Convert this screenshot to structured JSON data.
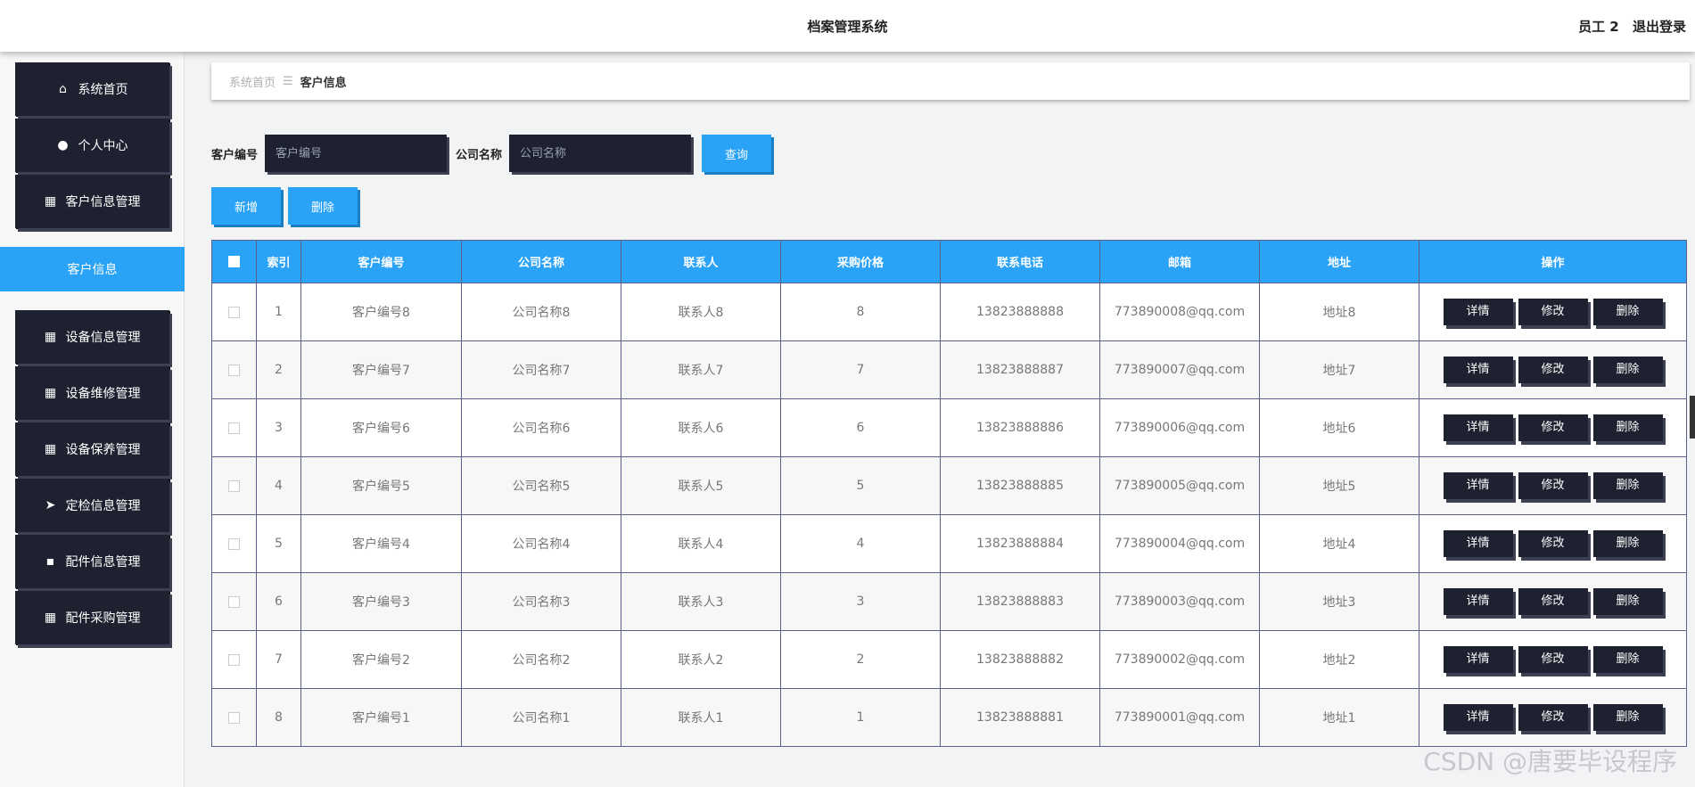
{
  "header": {
    "title": "档案管理系统",
    "user": "员工 2",
    "logout": "退出登录"
  },
  "sidebar": {
    "items": [
      {
        "label": "系统首页",
        "icon": "home-icon"
      },
      {
        "label": "个人中心",
        "icon": "user-icon"
      },
      {
        "label": "客户信息管理",
        "icon": "grid-icon"
      },
      {
        "label": "设备信息管理",
        "icon": "grid-icon"
      },
      {
        "label": "设备维修管理",
        "icon": "grid-icon"
      },
      {
        "label": "设备保养管理",
        "icon": "grid-icon"
      },
      {
        "label": "定检信息管理",
        "icon": "send-icon"
      },
      {
        "label": "配件信息管理",
        "icon": "chat-icon"
      },
      {
        "label": "配件采购管理",
        "icon": "grid-icon"
      }
    ],
    "active_sub": "客户信息"
  },
  "breadcrumb": {
    "home": "系统首页",
    "separator": "☰",
    "current": "客户信息"
  },
  "search": {
    "label_code": "客户编号",
    "placeholder_code": "客户编号",
    "label_company": "公司名称",
    "placeholder_company": "公司名称",
    "query": "查询"
  },
  "actions": {
    "add": "新增",
    "delete": "删除"
  },
  "table": {
    "headers": [
      "索引",
      "客户编号",
      "公司名称",
      "联系人",
      "采购价格",
      "联系电话",
      "邮箱",
      "地址",
      "操作"
    ],
    "row_buttons": {
      "detail": "详情",
      "edit": "修改",
      "delete": "删除"
    },
    "rows": [
      [
        "1",
        "客户编号8",
        "公司名称8",
        "联系人8",
        "8",
        "13823888888",
        "773890008@qq.com",
        "地址8"
      ],
      [
        "2",
        "客户编号7",
        "公司名称7",
        "联系人7",
        "7",
        "13823888887",
        "773890007@qq.com",
        "地址7"
      ],
      [
        "3",
        "客户编号6",
        "公司名称6",
        "联系人6",
        "6",
        "13823888886",
        "773890006@qq.com",
        "地址6"
      ],
      [
        "4",
        "客户编号5",
        "公司名称5",
        "联系人5",
        "5",
        "13823888885",
        "773890005@qq.com",
        "地址5"
      ],
      [
        "5",
        "客户编号4",
        "公司名称4",
        "联系人4",
        "4",
        "13823888884",
        "773890004@qq.com",
        "地址4"
      ],
      [
        "6",
        "客户编号3",
        "公司名称3",
        "联系人3",
        "3",
        "13823888883",
        "773890003@qq.com",
        "地址3"
      ],
      [
        "7",
        "客户编号2",
        "公司名称2",
        "联系人2",
        "2",
        "13823888882",
        "773890002@qq.com",
        "地址2"
      ],
      [
        "8",
        "客户编号1",
        "公司名称1",
        "联系人1",
        "1",
        "13823888881",
        "773890001@qq.com",
        "地址1"
      ]
    ]
  },
  "watermark": "CSDN @唐要毕设程序",
  "colors": {
    "accent": "#2aa2f5",
    "dark": "#1e2230"
  }
}
